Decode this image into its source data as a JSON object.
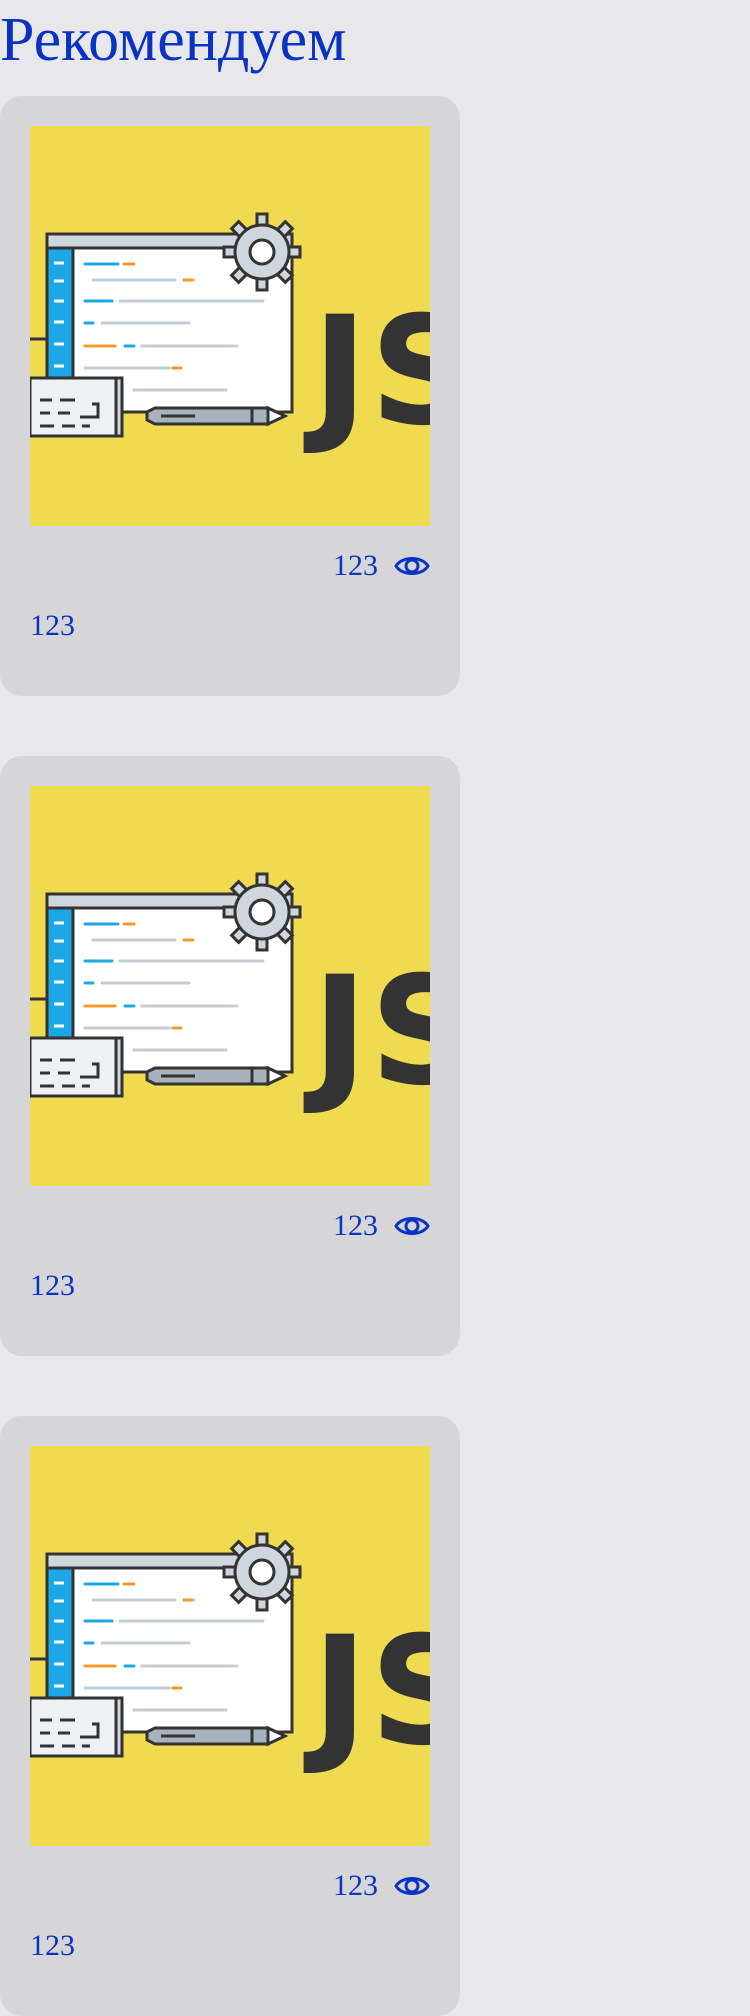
{
  "section": {
    "title": "Рекомендуем"
  },
  "cards": [
    {
      "image_alt": "JS",
      "views": "123",
      "caption": "123"
    },
    {
      "image_alt": "JS",
      "views": "123",
      "caption": "123"
    },
    {
      "image_alt": "JS",
      "views": "123",
      "caption": "123"
    }
  ],
  "icons": {
    "views": "eye-icon",
    "settings": "gear-icon"
  },
  "colors": {
    "accent": "#0a33c4",
    "card_bg": "#d6d6d8",
    "page_bg": "#e8e8eb",
    "image_bg": "#f0da50"
  }
}
